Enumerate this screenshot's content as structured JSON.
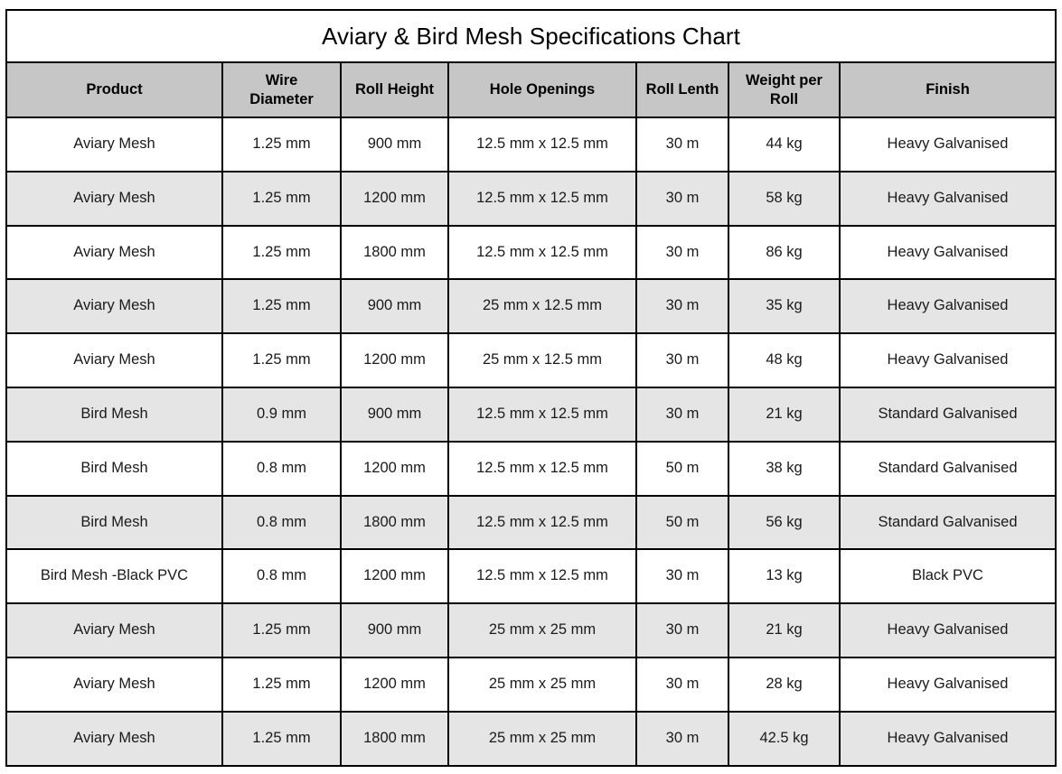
{
  "table": {
    "title": "Aviary & Bird Mesh Specifications Chart",
    "columns": [
      {
        "key": "product",
        "label": "Product"
      },
      {
        "key": "wire_diameter",
        "label": "Wire Diameter"
      },
      {
        "key": "roll_height",
        "label": "Roll Height"
      },
      {
        "key": "hole_openings",
        "label": "Hole Openings"
      },
      {
        "key": "roll_length",
        "label": "Roll Lenth"
      },
      {
        "key": "weight_per_roll",
        "label": "Weight per Roll"
      },
      {
        "key": "finish",
        "label": "Finish"
      }
    ],
    "header_labels": {
      "product": "Product",
      "wire_diameter_line1": "Wire",
      "wire_diameter_line2": "Diameter",
      "roll_height": "Roll Height",
      "hole_openings": "Hole Openings",
      "roll_length": "Roll Lenth",
      "weight_line1": "Weight per",
      "weight_line2": "Roll",
      "finish": "Finish"
    },
    "rows": [
      {
        "product": "Aviary Mesh",
        "wire_diameter": "1.25 mm",
        "roll_height": "900 mm",
        "hole_openings": "12.5 mm x 12.5 mm",
        "roll_length": "30 m",
        "weight_per_roll": "44 kg",
        "finish": "Heavy Galvanised",
        "shade": "white"
      },
      {
        "product": "Aviary Mesh",
        "wire_diameter": "1.25 mm",
        "roll_height": "1200 mm",
        "hole_openings": "12.5 mm x 12.5 mm",
        "roll_length": "30 m",
        "weight_per_roll": "58 kg",
        "finish": "Heavy Galvanised",
        "shade": "gray"
      },
      {
        "product": "Aviary Mesh",
        "wire_diameter": "1.25 mm",
        "roll_height": "1800 mm",
        "hole_openings": "12.5 mm x 12.5 mm",
        "roll_length": "30 m",
        "weight_per_roll": "86 kg",
        "finish": "Heavy Galvanised",
        "shade": "white"
      },
      {
        "product": "Aviary Mesh",
        "wire_diameter": "1.25 mm",
        "roll_height": "900 mm",
        "hole_openings": "25 mm x 12.5 mm",
        "roll_length": "30 m",
        "weight_per_roll": "35 kg",
        "finish": "Heavy Galvanised",
        "shade": "gray"
      },
      {
        "product": "Aviary Mesh",
        "wire_diameter": "1.25 mm",
        "roll_height": "1200 mm",
        "hole_openings": "25 mm x 12.5 mm",
        "roll_length": "30 m",
        "weight_per_roll": "48 kg",
        "finish": "Heavy Galvanised",
        "shade": "white"
      },
      {
        "product": "Bird Mesh",
        "wire_diameter": "0.9 mm",
        "roll_height": "900 mm",
        "hole_openings": "12.5 mm x 12.5 mm",
        "roll_length": "30 m",
        "weight_per_roll": "21 kg",
        "finish": "Standard Galvanised",
        "shade": "gray"
      },
      {
        "product": "Bird Mesh",
        "wire_diameter": "0.8 mm",
        "roll_height": "1200 mm",
        "hole_openings": "12.5 mm x 12.5 mm",
        "roll_length": "50 m",
        "weight_per_roll": "38 kg",
        "finish": "Standard Galvanised",
        "shade": "white"
      },
      {
        "product": "Bird Mesh",
        "wire_diameter": "0.8 mm",
        "roll_height": "1800 mm",
        "hole_openings": "12.5 mm x 12.5 mm",
        "roll_length": "50 m",
        "weight_per_roll": "56 kg",
        "finish": "Standard Galvanised",
        "shade": "gray"
      },
      {
        "product": "Bird Mesh -Black PVC",
        "wire_diameter": "0.8 mm",
        "roll_height": "1200 mm",
        "hole_openings": "12.5 mm x 12.5 mm",
        "roll_length": "30 m",
        "weight_per_roll": "13 kg",
        "finish": "Black PVC",
        "shade": "white"
      },
      {
        "product": "Aviary Mesh",
        "wire_diameter": "1.25 mm",
        "roll_height": "900 mm",
        "hole_openings": "25 mm x 25 mm",
        "roll_length": "30 m",
        "weight_per_roll": "21 kg",
        "finish": "Heavy Galvanised",
        "shade": "gray"
      },
      {
        "product": "Aviary Mesh",
        "wire_diameter": "1.25 mm",
        "roll_height": "1200 mm",
        "hole_openings": "25 mm x 25 mm",
        "roll_length": "30 m",
        "weight_per_roll": "28 kg",
        "finish": "Heavy Galvanised",
        "shade": "white"
      },
      {
        "product": "Aviary Mesh",
        "wire_diameter": "1.25 mm",
        "roll_height": "1800 mm",
        "hole_openings": "25 mm x 25 mm",
        "roll_length": "30 m",
        "weight_per_roll": "42.5 kg",
        "finish": "Heavy Galvanised",
        "shade": "gray"
      }
    ]
  },
  "chart_data": {
    "type": "table",
    "title": "Aviary & Bird Mesh Specifications Chart",
    "columns": [
      "Product",
      "Wire Diameter",
      "Roll Height",
      "Hole Openings",
      "Roll Lenth",
      "Weight per Roll",
      "Finish"
    ],
    "rows": [
      [
        "Aviary Mesh",
        "1.25 mm",
        "900 mm",
        "12.5 mm x 12.5 mm",
        "30 m",
        "44 kg",
        "Heavy Galvanised"
      ],
      [
        "Aviary Mesh",
        "1.25 mm",
        "1200 mm",
        "12.5 mm x 12.5 mm",
        "30 m",
        "58 kg",
        "Heavy Galvanised"
      ],
      [
        "Aviary Mesh",
        "1.25 mm",
        "1800 mm",
        "12.5 mm x 12.5 mm",
        "30 m",
        "86 kg",
        "Heavy Galvanised"
      ],
      [
        "Aviary Mesh",
        "1.25 mm",
        "900 mm",
        "25 mm x 12.5 mm",
        "30 m",
        "35 kg",
        "Heavy Galvanised"
      ],
      [
        "Aviary Mesh",
        "1.25 mm",
        "1200 mm",
        "25 mm x 12.5 mm",
        "30 m",
        "48 kg",
        "Heavy Galvanised"
      ],
      [
        "Bird Mesh",
        "0.9 mm",
        "900 mm",
        "12.5 mm x 12.5 mm",
        "30 m",
        "21 kg",
        "Standard Galvanised"
      ],
      [
        "Bird Mesh",
        "0.8 mm",
        "1200 mm",
        "12.5 mm x 12.5 mm",
        "50 m",
        "38 kg",
        "Standard Galvanised"
      ],
      [
        "Bird Mesh",
        "0.8 mm",
        "1800 mm",
        "12.5 mm x 12.5 mm",
        "50 m",
        "56 kg",
        "Standard Galvanised"
      ],
      [
        "Bird Mesh -Black PVC",
        "0.8 mm",
        "1200 mm",
        "12.5 mm x 12.5 mm",
        "30 m",
        "13 kg",
        "Black PVC"
      ],
      [
        "Aviary Mesh",
        "1.25 mm",
        "900 mm",
        "25 mm x 25 mm",
        "30 m",
        "21 kg",
        "Heavy Galvanised"
      ],
      [
        "Aviary Mesh",
        "1.25 mm",
        "1200 mm",
        "25 mm x 25 mm",
        "30 m",
        "28 kg",
        "Heavy Galvanised"
      ],
      [
        "Aviary Mesh",
        "1.25 mm",
        "1800 mm",
        "25 mm x 25 mm",
        "30 m",
        "42.5 kg",
        "Heavy Galvanised"
      ]
    ]
  },
  "colors": {
    "header_background": "#c6c6c6",
    "row_alt_background": "#e5e5e5",
    "row_background": "#ffffff",
    "border": "#000000",
    "text": "#000000"
  }
}
